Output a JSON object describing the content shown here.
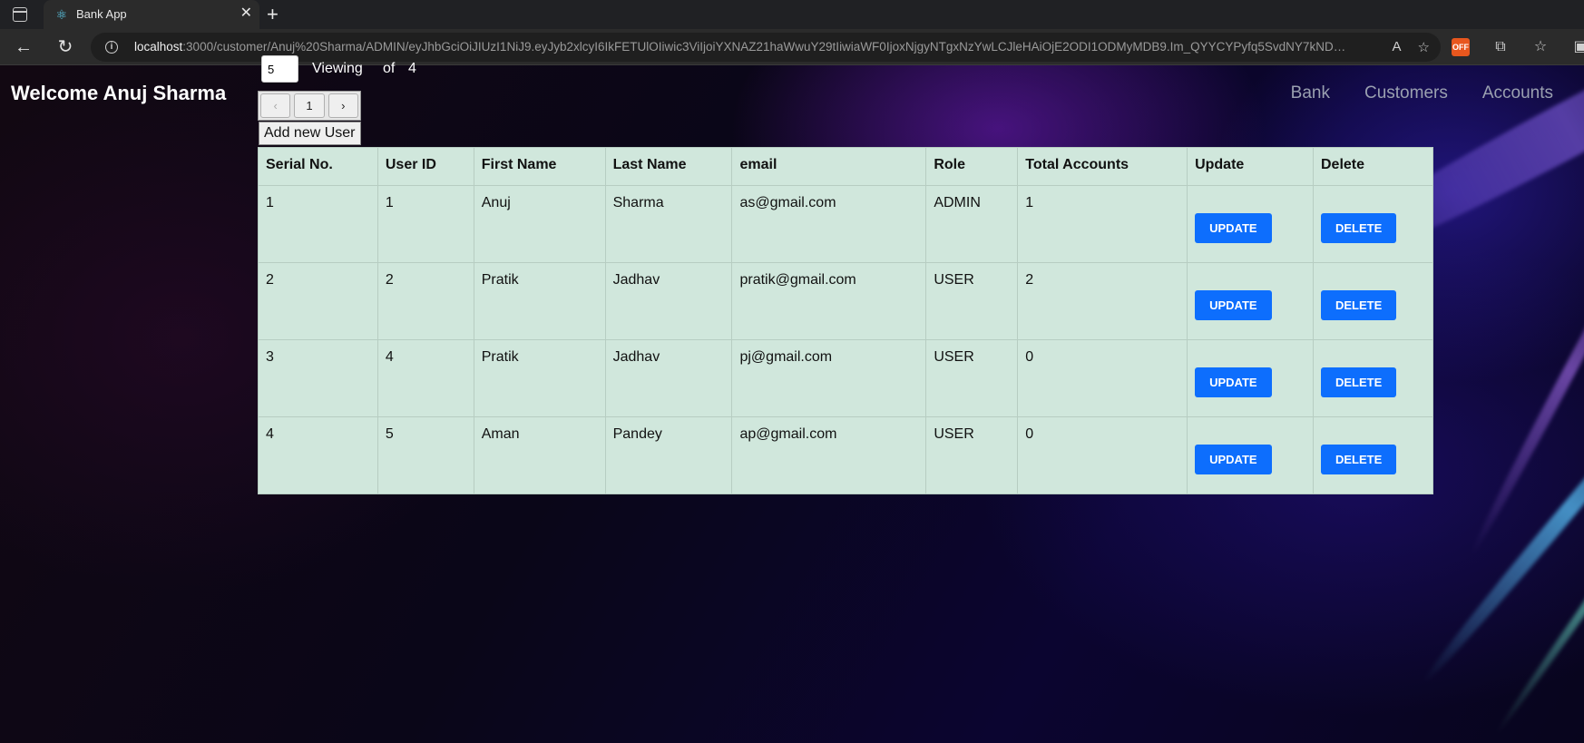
{
  "browser": {
    "tab_title": "Bank App",
    "url_host": "localhost",
    "url_rest": ":3000/customer/Anuj%20Sharma/ADMIN/eyJhbGciOiJIUzI1NiJ9.eyJyb2xlcyI6IkFETUlOIiwic3ViIjoiYXNAZ21haWwuY29tIiwiaWF0IjoxNjgyNTgxNzYwLCJleHAiOjE2ODI1ODMyMDB9.Im_QYYCYPyfq5SvdNY7kNDugBT..."
  },
  "header": {
    "welcome": "Welcome Anuj Sharma",
    "nav": [
      "Bank",
      "Customers",
      "Accounts"
    ]
  },
  "pagination": {
    "page_size": "5",
    "viewing_label": "Viewing",
    "of_label": "of",
    "total": "4",
    "current_page": "1"
  },
  "add_user_label": "Add new User",
  "table": {
    "headers": [
      "Serial No.",
      "User ID",
      "First Name",
      "Last Name",
      "email",
      "Role",
      "Total Accounts",
      "Update",
      "Delete"
    ],
    "rows": [
      {
        "serial": "1",
        "user_id": "1",
        "first": "Anuj",
        "last": "Sharma",
        "email": "as@gmail.com",
        "role": "ADMIN",
        "accounts": "1"
      },
      {
        "serial": "2",
        "user_id": "2",
        "first": "Pratik",
        "last": "Jadhav",
        "email": "pratik@gmail.com",
        "role": "USER",
        "accounts": "2"
      },
      {
        "serial": "3",
        "user_id": "4",
        "first": "Pratik",
        "last": "Jadhav",
        "email": "pj@gmail.com",
        "role": "USER",
        "accounts": "0"
      },
      {
        "serial": "4",
        "user_id": "5",
        "first": "Aman",
        "last": "Pandey",
        "email": "ap@gmail.com",
        "role": "USER",
        "accounts": "0"
      }
    ],
    "update_label": "UPDATE",
    "delete_label": "DELETE"
  }
}
